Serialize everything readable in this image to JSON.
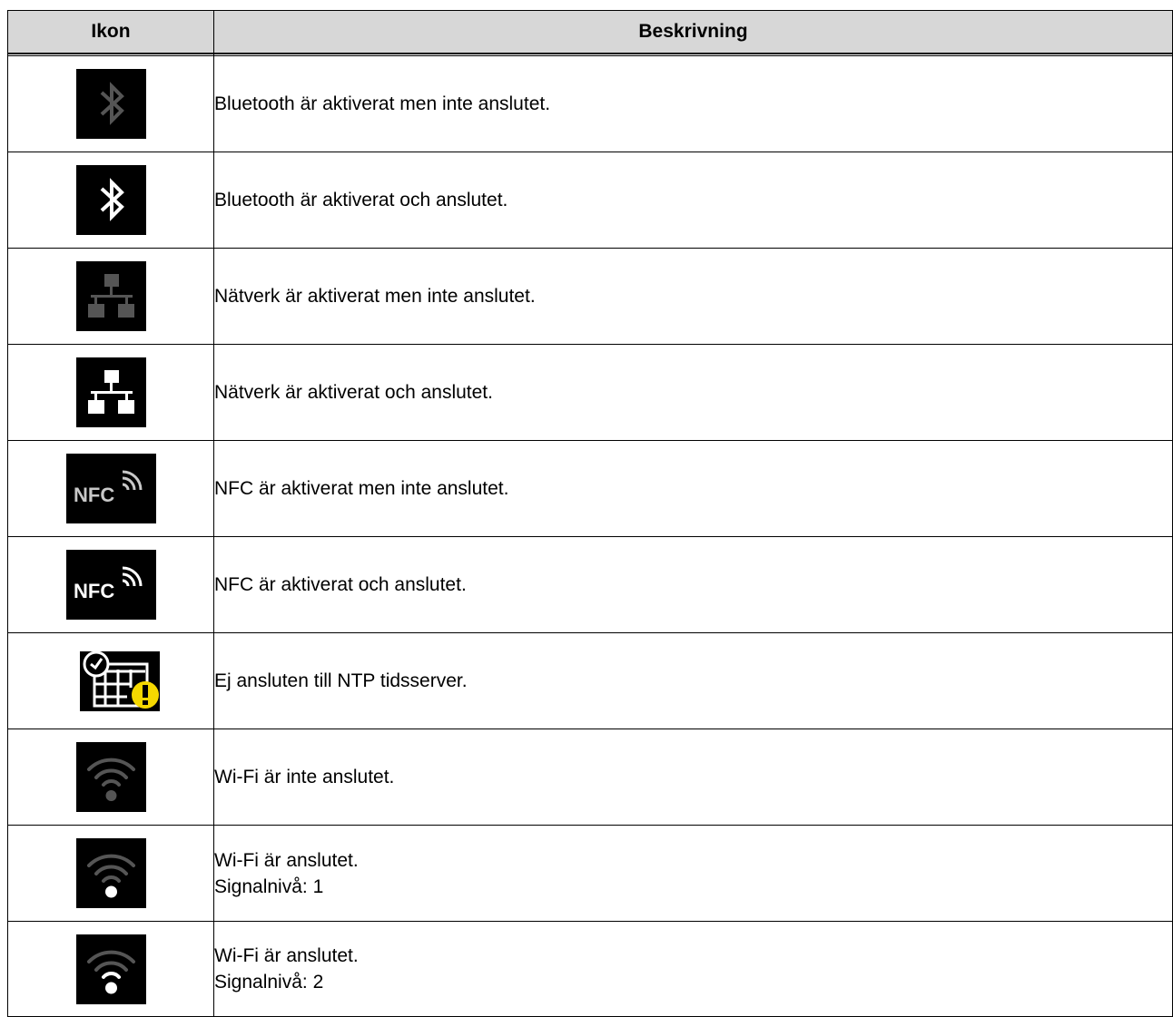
{
  "table": {
    "headers": {
      "icon": "Ikon",
      "description": "Beskrivning"
    },
    "rows": [
      {
        "icon": "bluetooth-inactive-icon",
        "line1": "Bluetooth är aktiverat men inte anslutet.",
        "line2": ""
      },
      {
        "icon": "bluetooth-active-icon",
        "line1": "Bluetooth är aktiverat och anslutet.",
        "line2": ""
      },
      {
        "icon": "network-inactive-icon",
        "line1": "Nätverk är aktiverat men inte anslutet.",
        "line2": ""
      },
      {
        "icon": "network-active-icon",
        "line1": "Nätverk är aktiverat och anslutet.",
        "line2": ""
      },
      {
        "icon": "nfc-inactive-icon",
        "line1": "NFC är aktiverat men inte anslutet.",
        "line2": ""
      },
      {
        "icon": "nfc-active-icon",
        "line1": "NFC är aktiverat och anslutet.",
        "line2": ""
      },
      {
        "icon": "ntp-warning-icon",
        "line1": "Ej ansluten till NTP tidsserver.",
        "line2": ""
      },
      {
        "icon": "wifi-disconnected-icon",
        "line1": "Wi-Fi är inte anslutet.",
        "line2": ""
      },
      {
        "icon": "wifi-signal-1-icon",
        "line1": "Wi-Fi är anslutet.",
        "line2": "Signalnivå: 1"
      },
      {
        "icon": "wifi-signal-2-icon",
        "line1": "Wi-Fi är anslutet.",
        "line2": "Signalnivå: 2"
      }
    ],
    "nfc_label": "NFC"
  },
  "colors": {
    "header_bg": "#d7d7d7",
    "icon_bg": "#000000",
    "inactive": "#555555",
    "active": "#ffffff",
    "warning": "#f5d800"
  }
}
